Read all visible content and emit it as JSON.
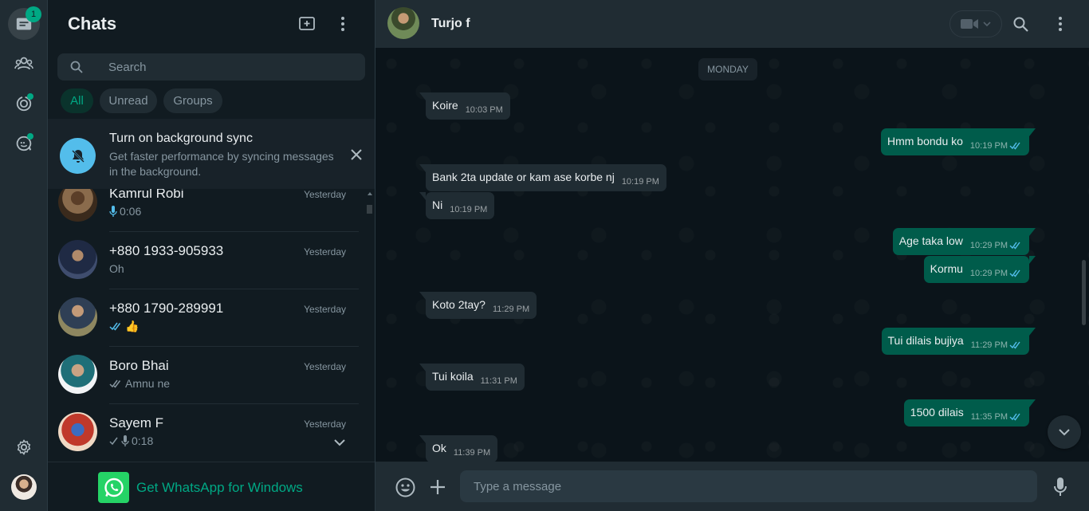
{
  "rail": {
    "chats_badge": "1"
  },
  "sidebar": {
    "title": "Chats",
    "search": {
      "placeholder": "Search"
    },
    "filters": [
      "All",
      "Unread",
      "Groups"
    ],
    "sync_banner": {
      "title": "Turn on background sync",
      "subtitle": "Get faster performance by syncing messages in the background."
    },
    "chats": [
      {
        "name": "Kamrul Robi",
        "time": "Yesterday",
        "preview": "0:06",
        "preview_icon": "mic-icon",
        "avatar_color": "#7a5a3a"
      },
      {
        "name": "+880 1933-905933",
        "time": "Yesterday",
        "preview": "Oh",
        "preview_icon": "",
        "avatar_color": "#2b3a55"
      },
      {
        "name": "+880 1790-289991",
        "time": "Yesterday",
        "preview": "👍",
        "preview_icon": "double-check-blue-icon",
        "avatar_color": "#6a6448"
      },
      {
        "name": "Boro Bhai",
        "time": "Yesterday",
        "preview": "Amnu ne",
        "preview_icon": "double-check-icon",
        "avatar_color": "#e7e9ec"
      },
      {
        "name": "Sayem F",
        "time": "Yesterday",
        "preview": "0:18",
        "preview_icon": "check-mic-icon",
        "avatar_color": "#b4342c"
      }
    ],
    "download": {
      "label": "Get WhatsApp for Windows"
    }
  },
  "conversation": {
    "contact_name": "Turjo f",
    "day_label": "MONDAY",
    "messages": [
      {
        "dir": "in",
        "text": "Koire",
        "time": "10:03 PM"
      },
      {
        "dir": "out",
        "text": "Hmm bondu ko",
        "time": "10:19 PM"
      },
      {
        "dir": "in",
        "text": "Bank 2ta update or kam ase korbe nj",
        "time": "10:19 PM"
      },
      {
        "dir": "in",
        "text": "Ni",
        "time": "10:19 PM"
      },
      {
        "dir": "out",
        "text": "Age taka low",
        "time": "10:29 PM"
      },
      {
        "dir": "out",
        "text": "Kormu",
        "time": "10:29 PM"
      },
      {
        "dir": "in",
        "text": "Koto 2tay?",
        "time": "11:29 PM"
      },
      {
        "dir": "out",
        "text": "Tui dilais bujiya",
        "time": "11:29 PM"
      },
      {
        "dir": "in",
        "text": "Tui koila",
        "time": "11:31 PM"
      },
      {
        "dir": "out",
        "text": "1500 dilais",
        "time": "11:35 PM"
      },
      {
        "dir": "in",
        "text": "Ok",
        "time": "11:39 PM"
      }
    ],
    "composer": {
      "placeholder": "Type a message"
    }
  },
  "colors": {
    "accent": "#00a884",
    "outgoing_bubble": "#005c4b",
    "incoming_bubble": "#202c33",
    "read_tick": "#53bdeb"
  }
}
